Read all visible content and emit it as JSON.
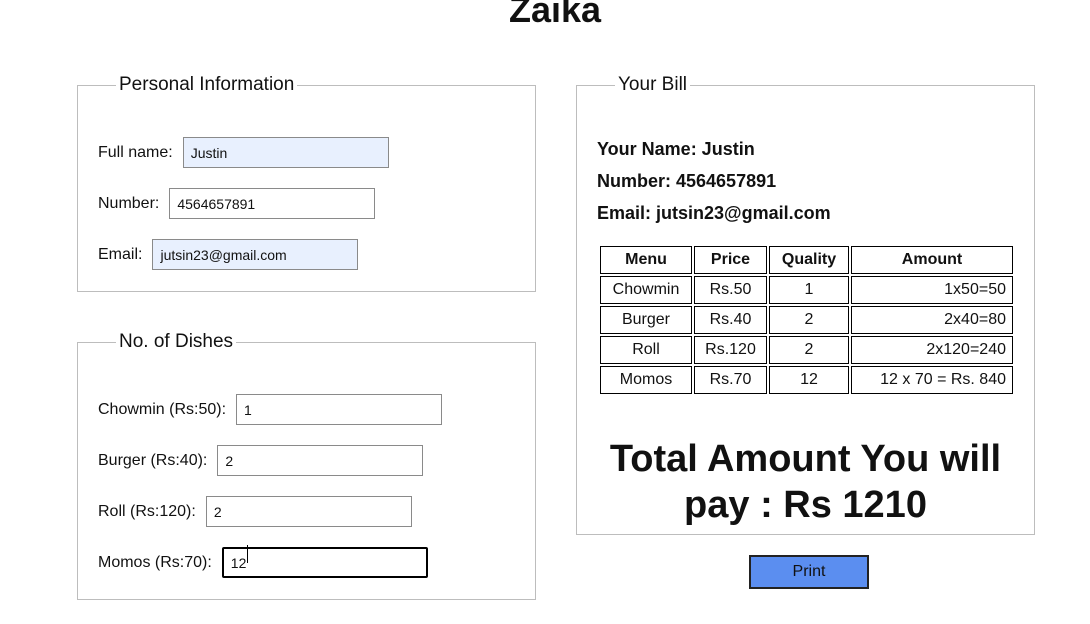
{
  "page": {
    "title": "Zaika"
  },
  "personal": {
    "legend": "Personal Information",
    "full_name": {
      "label": "Full name:",
      "value": "Justin"
    },
    "number": {
      "label": "Number:",
      "value": "4564657891"
    },
    "email": {
      "label": "Email:",
      "value": "jutsin23@gmail.com"
    }
  },
  "dishes": {
    "legend": "No. of Dishes",
    "items": [
      {
        "label": "Chowmin (Rs:50):",
        "value": "1"
      },
      {
        "label": "Burger (Rs:40):",
        "value": "2"
      },
      {
        "label": "Roll (Rs:120):",
        "value": "2"
      },
      {
        "label": "Momos (Rs:70):",
        "value": "12"
      }
    ]
  },
  "bill": {
    "legend": "Your Bill",
    "name_line": "Your Name: Justin",
    "number_line": "Number: 4564657891",
    "email_line": "Email: jutsin23@gmail.com",
    "headers": [
      "Menu",
      "Price",
      "Quality",
      "Amount"
    ],
    "rows": [
      {
        "menu": "Chowmin",
        "price": "Rs.50",
        "qty": "1",
        "amount": "1x50=50"
      },
      {
        "menu": "Burger",
        "price": "Rs.40",
        "qty": "2",
        "amount": "2x40=80"
      },
      {
        "menu": "Roll",
        "price": "Rs.120",
        "qty": "2",
        "amount": "2x120=240"
      },
      {
        "menu": "Momos",
        "price": "Rs.70",
        "qty": "12",
        "amount": "12 x 70 = Rs. 840"
      }
    ],
    "total_line1": "Total Amount You will",
    "total_line2": "pay : Rs 1210"
  },
  "actions": {
    "print_label": "Print"
  },
  "colors": {
    "autofill_bg": "#e8f0fe",
    "print_button": "#5b8ef0"
  }
}
